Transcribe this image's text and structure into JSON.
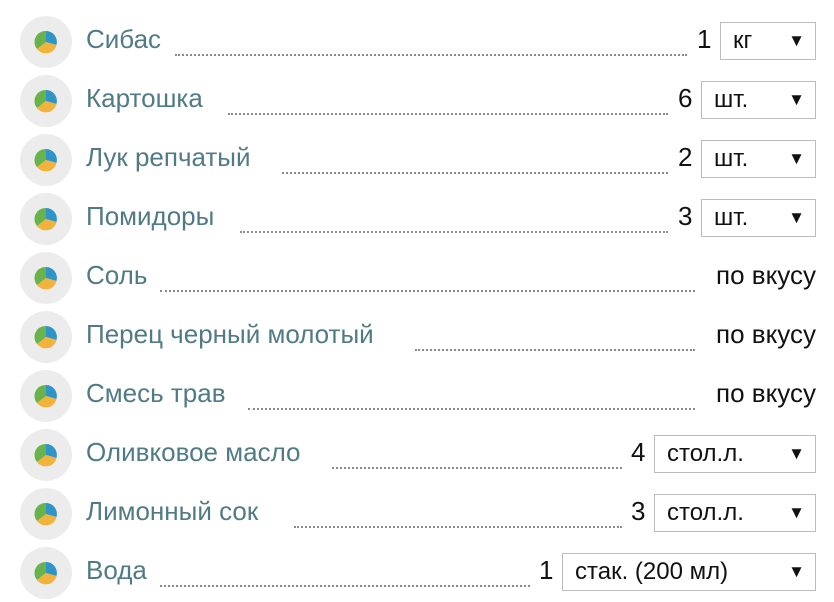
{
  "ingredients": [
    {
      "name": "Сибас",
      "qty": "1",
      "unit": "кг"
    },
    {
      "name": "Картошка",
      "qty": "6",
      "unit": "шт."
    },
    {
      "name": "Лук репчатый",
      "qty": "2",
      "unit": "шт."
    },
    {
      "name": "Помидоры",
      "qty": "3",
      "unit": "шт."
    },
    {
      "name": "Соль",
      "amount": "по вкусу"
    },
    {
      "name": "Перец черный молотый",
      "amount": "по вкусу"
    },
    {
      "name": "Смесь трав",
      "amount": "по вкусу"
    },
    {
      "name": "Оливковое масло",
      "qty": "4",
      "unit": "стол.л."
    },
    {
      "name": "Лимонный сок",
      "qty": "3",
      "unit": "стол.л."
    },
    {
      "name": "Вода",
      "qty": "1",
      "unit": "стак. (200 мл)"
    }
  ],
  "dropdown_arrow": "▼",
  "icon": "food-category-icon",
  "colors": {
    "name_text": "#517b84",
    "icon_bg": "#ececec"
  }
}
